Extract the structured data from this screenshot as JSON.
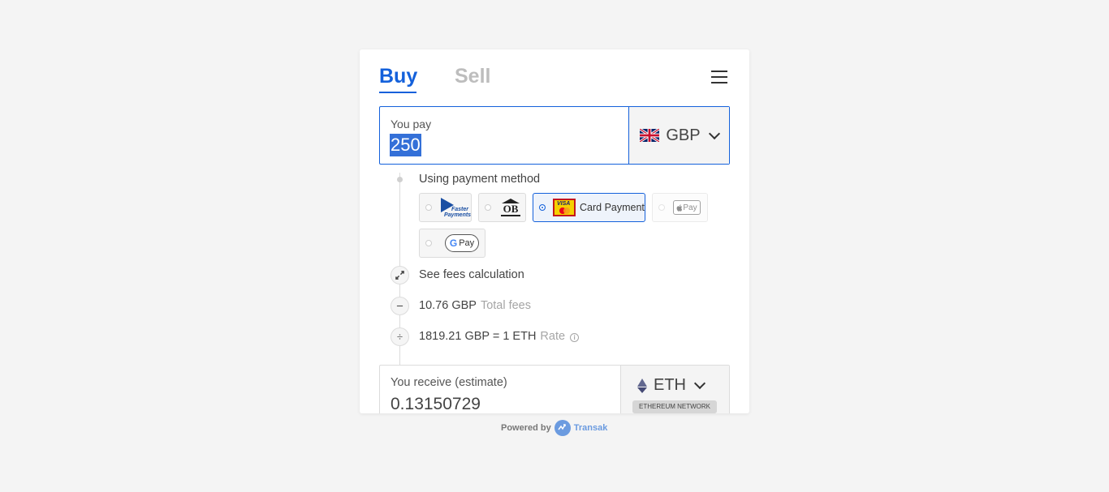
{
  "tabs": {
    "buy": "Buy",
    "sell": "Sell"
  },
  "pay": {
    "label": "You pay",
    "amount": "250",
    "currency": "GBP"
  },
  "payment_method": {
    "label": "Using payment method",
    "options": [
      {
        "id": "faster-payments",
        "logo_text": "Faster Payments",
        "selected": false,
        "disabled": false
      },
      {
        "id": "open-banking",
        "logo_text": "OB",
        "selected": false,
        "disabled": false
      },
      {
        "id": "card-payment",
        "label": "Card Payment",
        "logo_text": "VISA",
        "selected": true,
        "disabled": false
      },
      {
        "id": "apple-pay",
        "logo_text": "Pay",
        "selected": false,
        "disabled": true
      },
      {
        "id": "google-pay",
        "logo_text": "Pay",
        "selected": false,
        "disabled": false
      }
    ]
  },
  "fees": {
    "see_fees_label": "See fees calculation",
    "total_fees_value": "10.76 GBP",
    "total_fees_label": "Total fees",
    "rate_value": "1819.21 GBP = 1 ETH",
    "rate_label": "Rate",
    "info_glyph": "i"
  },
  "receive": {
    "label": "You receive (estimate)",
    "amount": "0.13150729",
    "currency": "ETH",
    "network": "ETHEREUM NETWORK"
  },
  "footer": {
    "powered_by": "Powered by",
    "brand": "Transak"
  },
  "colors": {
    "accent": "#1461db",
    "brand": "#6b9be0"
  }
}
